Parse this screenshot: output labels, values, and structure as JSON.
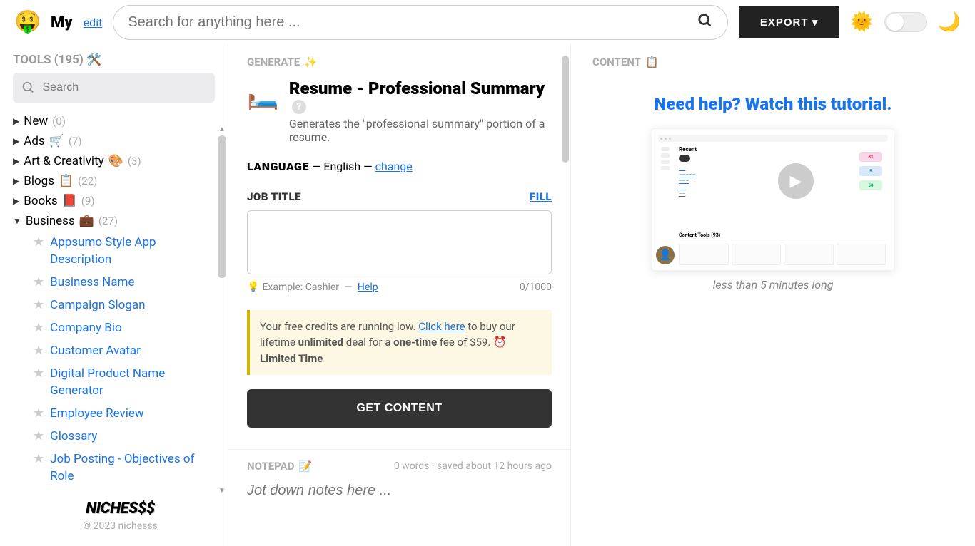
{
  "topbar": {
    "brand": "My",
    "edit_link": "edit",
    "search_placeholder": "Search for anything here ...",
    "export_label": "EXPORT"
  },
  "sidebar": {
    "header": "TOOLS (195) 🛠️",
    "search_placeholder": "Search",
    "categories": [
      {
        "label": "New",
        "icon": "",
        "count": "(0)",
        "expanded": false
      },
      {
        "label": "Ads",
        "icon": "🛒",
        "count": "(7)",
        "expanded": false
      },
      {
        "label": "Art & Creativity",
        "icon": "🎨",
        "count": "(3)",
        "expanded": false
      },
      {
        "label": "Blogs",
        "icon": "📋",
        "count": "(22)",
        "expanded": false
      },
      {
        "label": "Books",
        "icon": "📕",
        "count": "(9)",
        "expanded": false
      },
      {
        "label": "Business",
        "icon": "💼",
        "count": "(27)",
        "expanded": true
      }
    ],
    "subitems": [
      "Appsumo Style App Description",
      "Business Name",
      "Campaign Slogan",
      "Company Bio",
      "Customer Avatar",
      "Digital Product Name Generator",
      "Employee Review",
      "Glossary",
      "Job Posting - Objectives of Role"
    ],
    "footer_logo": "NICHES$$",
    "copyright": "© 2023 nichesss"
  },
  "generate": {
    "section_label": "GENERATE",
    "sparkle": "✨",
    "tool_title": "Resume - Professional Summary",
    "tool_desc": "Generates the \"professional summary\" portion of a resume.",
    "language_label": "LANGUAGE",
    "language_value": "English",
    "change_link": "change",
    "field_label": "JOB TITLE",
    "fill_label": "FILL",
    "example_text": "Example: Cashier",
    "help_link": "Help",
    "char_count": "0/1000",
    "promo_prefix": "Your free credits are running low. ",
    "promo_click": "Click here",
    "promo_mid": " to buy our lifetime ",
    "promo_unlimited": "unlimited",
    "promo_mid2": " deal for a ",
    "promo_onetime": "one-time",
    "promo_end": " fee of $59. ⏰ ",
    "promo_limited": "Limited Time",
    "button_label": "GET CONTENT"
  },
  "notepad": {
    "section_label": "NOTEPAD",
    "icon": "📝",
    "meta": "0 words · saved about 12 hours ago",
    "placeholder": "Jot down notes here ..."
  },
  "content_panel": {
    "section_label": "CONTENT",
    "icon": "📋",
    "tutorial_title": "Need help? Watch this tutorial.",
    "video_caption": "less than 5 minutes long",
    "vid_recent": "Recent",
    "vid_tools": "Content Tools (93)",
    "vid_pill1": "81",
    "vid_pill2": "5",
    "vid_pill3": "58"
  }
}
